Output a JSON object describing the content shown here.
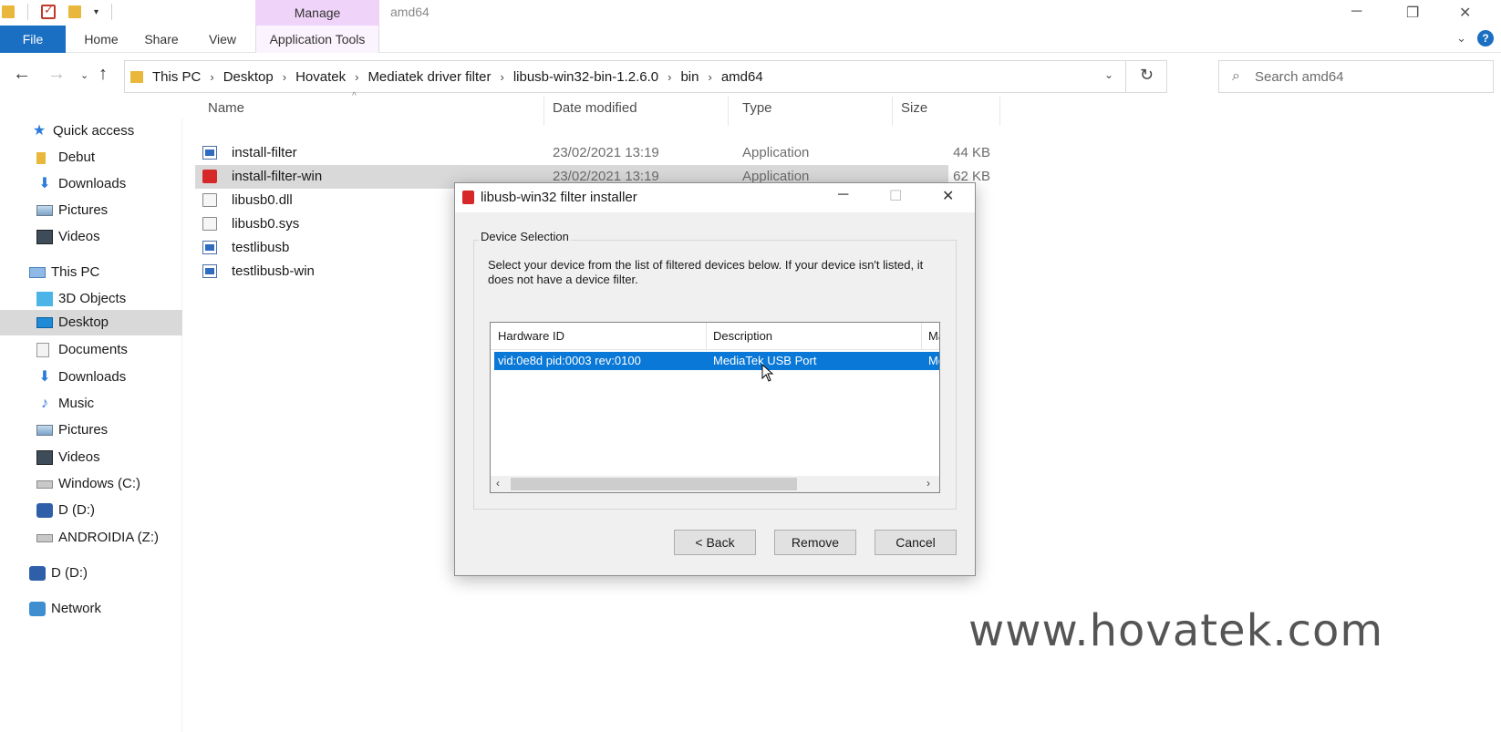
{
  "window": {
    "title": "amd64",
    "context_tab": "Manage",
    "minimize": "─",
    "maximize": "❐",
    "close": "✕"
  },
  "ribbon": {
    "tabs": [
      "File",
      "Home",
      "Share",
      "View",
      "Application Tools"
    ],
    "help": "?"
  },
  "address": {
    "crumbs": [
      "This PC",
      "Desktop",
      "Hovatek",
      "Mediatek driver filter",
      "libusb-win32-bin-1.2.6.0",
      "bin",
      "amd64"
    ],
    "search_placeholder": "Search amd64"
  },
  "sidebar": {
    "items": [
      {
        "label": "Quick access",
        "icon": "star-icon"
      },
      {
        "label": "Debut",
        "icon": "folder-icon"
      },
      {
        "label": "Downloads",
        "icon": "download-icon"
      },
      {
        "label": "Pictures",
        "icon": "pictures-icon"
      },
      {
        "label": "Videos",
        "icon": "videos-icon"
      },
      {
        "label": "This PC",
        "icon": "computer-icon"
      },
      {
        "label": "3D Objects",
        "icon": "3d-objects-icon"
      },
      {
        "label": "Desktop",
        "icon": "desktop-icon"
      },
      {
        "label": "Documents",
        "icon": "documents-icon"
      },
      {
        "label": "Downloads",
        "icon": "download-icon"
      },
      {
        "label": "Music",
        "icon": "music-icon"
      },
      {
        "label": "Pictures",
        "icon": "pictures-icon"
      },
      {
        "label": "Videos",
        "icon": "videos-icon"
      },
      {
        "label": "Windows (C:)",
        "icon": "drive-icon"
      },
      {
        "label": "D (D:)",
        "icon": "usb-drive-icon"
      },
      {
        "label": "ANDROIDIA (Z:)",
        "icon": "network-drive-icon"
      },
      {
        "label": "D (D:)",
        "icon": "usb-drive-icon"
      },
      {
        "label": "Network",
        "icon": "network-icon"
      }
    ],
    "selected": "Desktop"
  },
  "files": {
    "columns": [
      "Name",
      "Date modified",
      "Type",
      "Size"
    ],
    "rows": [
      {
        "name": "install-filter",
        "date": "23/02/2021 13:19",
        "type": "Application",
        "size": "44 KB"
      },
      {
        "name": "install-filter-win",
        "date": "23/02/2021 13:19",
        "type": "Application",
        "size": "62 KB"
      },
      {
        "name": "libusb0.dll",
        "date": "",
        "type": "",
        "size": ""
      },
      {
        "name": "libusb0.sys",
        "date": "",
        "type": "",
        "size": ""
      },
      {
        "name": "testlibusb",
        "date": "",
        "type": "",
        "size": ""
      },
      {
        "name": "testlibusb-win",
        "date": "",
        "type": "",
        "size": ""
      }
    ]
  },
  "dialog": {
    "title": "libusb-win32 filter installer",
    "group_label": "Device Selection",
    "description": "Select your device from the list of filtered devices below. If your device isn't listed, it does not have a device filter.",
    "list_columns": [
      "Hardware ID",
      "Description",
      "Ma"
    ],
    "list_rows": [
      {
        "hardware_id": "vid:0e8d pid:0003 rev:0100",
        "description": "MediaTek USB Port",
        "manufacturer": "Me"
      }
    ],
    "buttons": {
      "back": "< Back",
      "remove": "Remove",
      "cancel": "Cancel"
    }
  },
  "watermark": "www.hovatek.com",
  "colors": {
    "accent": "#1a6fc2",
    "selection": "#0a78d7",
    "manage_tab": "#efd3f8"
  }
}
